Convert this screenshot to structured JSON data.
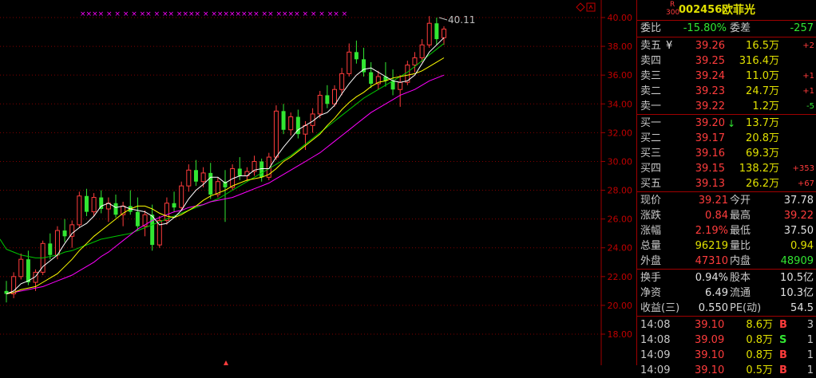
{
  "colors": {
    "up": "#ff3c3c",
    "down": "#32e632",
    "flat": "#e0e0e0",
    "volume": "#e0e000",
    "ma5": "#ffffff",
    "ma10": "#ffff00",
    "ma20": "#ff00ff",
    "ma60": "#00c800",
    "grid": "#800000",
    "marker": "#ff00ff"
  },
  "chart": {
    "y_ticks": [
      "40.00",
      "38.00",
      "36.00",
      "34.00",
      "32.00",
      "30.00",
      "28.00",
      "26.00",
      "24.00",
      "22.00",
      "20.00",
      "18.00"
    ],
    "max_label": "40.11",
    "marker_text": "×××× × × × × ×× × ×× ×××× × ×××××××× ×× ×××× × × × ×× ×"
  },
  "chart_data": {
    "type": "candlestick",
    "ylim": [
      16.5,
      41.2
    ],
    "series": [
      {
        "name": "MA5"
      },
      {
        "name": "MA10"
      },
      {
        "name": "MA20"
      },
      {
        "name": "MA60"
      }
    ],
    "candles": [
      [
        21.0,
        21.7,
        20.2,
        20.8
      ],
      [
        20.8,
        22.3,
        20.5,
        22.0
      ],
      [
        22.0,
        23.6,
        21.8,
        23.2
      ],
      [
        23.2,
        23.8,
        21.4,
        21.6
      ],
      [
        21.6,
        22.5,
        21.0,
        22.3
      ],
      [
        22.3,
        24.5,
        22.1,
        24.3
      ],
      [
        24.3,
        25.0,
        23.2,
        23.5
      ],
      [
        23.5,
        25.5,
        23.2,
        25.2
      ],
      [
        25.2,
        26.0,
        24.4,
        24.8
      ],
      [
        24.8,
        25.9,
        24.0,
        25.6
      ],
      [
        25.6,
        27.9,
        25.4,
        27.6
      ],
      [
        27.6,
        28.1,
        26.2,
        26.5
      ],
      [
        26.5,
        27.8,
        26.2,
        27.5
      ],
      [
        27.5,
        28.0,
        26.4,
        26.7
      ],
      [
        26.7,
        27.5,
        25.8,
        27.1
      ],
      [
        27.1,
        27.7,
        26.1,
        26.3
      ],
      [
        26.3,
        27.2,
        25.5,
        26.9
      ],
      [
        26.9,
        28.0,
        26.3,
        26.5
      ],
      [
        26.5,
        27.5,
        25.2,
        25.5
      ],
      [
        25.5,
        26.6,
        24.8,
        26.3
      ],
      [
        26.3,
        27.0,
        23.8,
        24.2
      ],
      [
        24.2,
        26.2,
        24.0,
        25.9
      ],
      [
        25.9,
        27.5,
        25.6,
        27.1
      ],
      [
        27.1,
        27.9,
        26.5,
        26.8
      ],
      [
        26.8,
        28.6,
        26.6,
        28.3
      ],
      [
        28.3,
        29.8,
        27.9,
        29.4
      ],
      [
        29.4,
        30.1,
        28.3,
        28.6
      ],
      [
        28.6,
        29.6,
        28.2,
        29.2
      ],
      [
        29.2,
        29.9,
        27.4,
        27.7
      ],
      [
        27.7,
        28.9,
        27.5,
        28.6
      ],
      [
        28.6,
        29.4,
        25.8,
        28.2
      ],
      [
        28.2,
        29.8,
        28.0,
        29.5
      ],
      [
        29.5,
        30.3,
        28.7,
        29.0
      ],
      [
        29.0,
        29.6,
        28.6,
        29.3
      ],
      [
        29.3,
        30.4,
        29.0,
        30.0
      ],
      [
        30.0,
        30.2,
        28.6,
        28.9
      ],
      [
        28.9,
        30.6,
        28.7,
        30.3
      ],
      [
        30.3,
        33.9,
        30.1,
        33.5
      ],
      [
        33.5,
        34.0,
        31.9,
        32.2
      ],
      [
        32.2,
        33.4,
        31.8,
        33.1
      ],
      [
        33.1,
        33.6,
        31.6,
        31.9
      ],
      [
        31.9,
        32.8,
        30.8,
        32.5
      ],
      [
        32.5,
        33.7,
        32.0,
        33.3
      ],
      [
        33.3,
        34.9,
        33.0,
        34.6
      ],
      [
        34.6,
        35.3,
        33.7,
        34.0
      ],
      [
        34.0,
        35.3,
        33.8,
        35.0
      ],
      [
        35.0,
        36.5,
        34.6,
        36.1
      ],
      [
        36.1,
        38.2,
        35.9,
        37.6
      ],
      [
        37.6,
        38.4,
        36.8,
        37.1
      ],
      [
        37.1,
        37.9,
        35.9,
        36.2
      ],
      [
        36.2,
        36.9,
        35.1,
        35.4
      ],
      [
        35.4,
        36.3,
        35.0,
        35.9
      ],
      [
        35.9,
        36.9,
        35.2,
        35.6
      ],
      [
        35.6,
        36.4,
        34.6,
        35.0
      ],
      [
        35.0,
        36.0,
        33.8,
        35.5
      ],
      [
        35.5,
        37.0,
        35.3,
        36.7
      ],
      [
        36.7,
        37.6,
        36.2,
        37.2
      ],
      [
        37.2,
        38.5,
        36.9,
        38.1
      ],
      [
        38.1,
        40.1,
        37.9,
        39.6
      ],
      [
        39.6,
        40.0,
        38.1,
        38.5
      ],
      [
        38.6,
        39.4,
        38.1,
        39.2
      ]
    ],
    "ma5": [
      20.8,
      21.0,
      21.5,
      21.7,
      22.0,
      22.7,
      23.1,
      23.5,
      24.3,
      25.0,
      25.4,
      25.7,
      26.2,
      26.9,
      27.1,
      26.8,
      26.9,
      26.7,
      26.6,
      26.5,
      26.2,
      25.6,
      25.7,
      26.1,
      26.6,
      27.4,
      28.0,
      28.4,
      28.9,
      28.9,
      28.5,
      28.8,
      29.0,
      29.0,
      29.4,
      29.5,
      29.5,
      30.3,
      31.0,
      31.6,
      32.2,
      32.5,
      32.8,
      33.2,
      33.4,
      33.9,
      34.7,
      35.4,
      36.0,
      36.4,
      36.5,
      36.2,
      35.9,
      35.6,
      35.5,
      35.6,
      36.0,
      36.8,
      37.6,
      38.1,
      38.6
    ],
    "ma10": [
      20.8,
      20.9,
      21.1,
      21.2,
      21.3,
      21.6,
      21.9,
      22.2,
      22.7,
      23.2,
      23.8,
      24.3,
      24.8,
      25.2,
      25.6,
      26.0,
      26.4,
      26.7,
      26.9,
      26.9,
      26.7,
      26.4,
      26.2,
      26.1,
      26.3,
      26.6,
      26.9,
      27.3,
      27.6,
      27.8,
      28.0,
      28.3,
      28.5,
      28.7,
      28.8,
      28.9,
      29.1,
      29.5,
      30.0,
      30.3,
      30.7,
      31.1,
      31.5,
      31.9,
      32.5,
      33.0,
      33.6,
      34.1,
      34.5,
      34.8,
      35.2,
      35.5,
      35.6,
      35.8,
      35.9,
      36.0,
      36.1,
      36.3,
      36.6,
      36.9,
      37.2
    ],
    "ma20": [
      20.8,
      20.9,
      21.0,
      21.1,
      21.2,
      21.3,
      21.5,
      21.7,
      21.9,
      22.1,
      22.4,
      22.7,
      23.0,
      23.4,
      23.7,
      24.1,
      24.5,
      24.9,
      25.3,
      25.6,
      25.9,
      26.1,
      26.3,
      26.5,
      26.6,
      26.8,
      26.9,
      27.0,
      27.2,
      27.3,
      27.4,
      27.5,
      27.7,
      27.9,
      28.1,
      28.3,
      28.5,
      28.8,
      29.1,
      29.4,
      29.7,
      30.0,
      30.3,
      30.6,
      31.0,
      31.4,
      31.8,
      32.2,
      32.6,
      33.0,
      33.4,
      33.7,
      34.0,
      34.3,
      34.6,
      34.8,
      35.0,
      35.3,
      35.6,
      35.8,
      36.0
    ],
    "ma60": [
      23.9,
      23.7,
      23.5,
      23.4,
      23.3,
      23.3,
      23.4,
      23.5,
      23.7,
      23.8,
      24.0,
      24.2,
      24.4,
      24.6,
      24.7,
      24.8,
      24.9,
      25.0,
      25.2,
      25.4,
      25.6,
      25.8,
      26.0,
      26.2,
      26.4,
      26.6,
      26.8,
      27.0,
      27.2,
      27.4,
      27.7,
      28.0,
      28.3,
      28.6,
      28.9,
      29.2,
      29.5,
      29.8,
      30.1,
      30.4,
      30.8,
      31.2,
      31.6,
      32.0,
      32.4,
      32.8,
      33.2,
      33.6,
      34.0,
      34.4,
      34.7,
      35.0,
      35.3,
      35.6,
      35.9,
      36.2,
      36.6,
      37.0,
      37.4,
      37.8,
      38.2
    ]
  },
  "quote": {
    "badge_top": "R",
    "badge_bottom": "300",
    "code": "002456",
    "name": "欧菲光",
    "weibi_label": "委比",
    "weibi_value": "-15.80%",
    "weicha_label": "委差",
    "weicha_value": "-257",
    "sell": [
      {
        "label": "卖五",
        "mark": "¥",
        "price": "39.26",
        "vol": "16.5万",
        "chg": "+2"
      },
      {
        "label": "卖四",
        "mark": "",
        "price": "39.25",
        "vol": "316.4万",
        "chg": ""
      },
      {
        "label": "卖三",
        "mark": "",
        "price": "39.24",
        "vol": "11.0万",
        "chg": "+1"
      },
      {
        "label": "卖二",
        "mark": "",
        "price": "39.23",
        "vol": "24.7万",
        "chg": "+1"
      },
      {
        "label": "卖一",
        "mark": "",
        "price": "39.22",
        "vol": "1.2万",
        "chg": "-5"
      }
    ],
    "buy": [
      {
        "label": "买一",
        "mark": "",
        "price": "39.20",
        "vol": "13.7万",
        "chg": ""
      },
      {
        "label": "买二",
        "mark": "",
        "price": "39.17",
        "vol": "20.8万",
        "chg": ""
      },
      {
        "label": "买三",
        "mark": "",
        "price": "39.16",
        "vol": "69.3万",
        "chg": ""
      },
      {
        "label": "买四",
        "mark": "",
        "price": "39.15",
        "vol": "138.2万",
        "chg": "+353"
      },
      {
        "label": "买五",
        "mark": "",
        "price": "39.13",
        "vol": "26.2万",
        "chg": "+67"
      }
    ],
    "stats": [
      {
        "l1": "现价",
        "v1": "39.21",
        "c1": "red",
        "l2": "今开",
        "v2": "37.78",
        "c2": "white"
      },
      {
        "l1": "涨跌",
        "v1": "0.84",
        "c1": "red",
        "l2": "最高",
        "v2": "39.22",
        "c2": "red"
      },
      {
        "l1": "涨幅",
        "v1": "2.19%",
        "c1": "red",
        "l2": "最低",
        "v2": "37.50",
        "c2": "white"
      },
      {
        "l1": "总量",
        "v1": "96219",
        "c1": "yellow",
        "l2": "量比",
        "v2": "0.94",
        "c2": "yellow"
      },
      {
        "l1": "外盘",
        "v1": "47310",
        "c1": "red",
        "l2": "内盘",
        "v2": "48909",
        "c2": "green"
      }
    ],
    "info": [
      {
        "l1": "换手",
        "v1": "0.94%",
        "l2": "股本",
        "v2": "10.5亿"
      },
      {
        "l1": "净资",
        "v1": "6.49",
        "l2": "流通",
        "v2": "10.3亿"
      },
      {
        "l1": "收益(三)",
        "v1": "0.550",
        "l2": "PE(动)",
        "v2": "54.5"
      }
    ],
    "ticks": [
      {
        "time": "14:08",
        "price": "39.10",
        "vol": "8.6万",
        "bs": "B",
        "cnt": "3"
      },
      {
        "time": "14:08",
        "price": "39.09",
        "vol": "0.8万",
        "bs": "S",
        "cnt": "1"
      },
      {
        "time": "14:09",
        "price": "39.10",
        "vol": "0.8万",
        "bs": "B",
        "cnt": "1"
      },
      {
        "time": "14:09",
        "price": "39.10",
        "vol": "0.5万",
        "bs": "B",
        "cnt": "1"
      }
    ]
  }
}
